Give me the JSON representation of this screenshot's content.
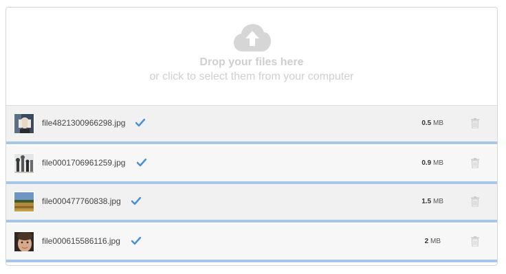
{
  "dropzone": {
    "icon": "cloud-upload-icon",
    "title": "Drop your files here",
    "subtitle": "or click to select them from your computer"
  },
  "colors": {
    "accent": "#4a90d9",
    "progress_bar": "#a7c7e9",
    "muted_text": "#cfcfcf"
  },
  "files": [
    {
      "name": "file4821300966298.jpg",
      "size_value": "0.5",
      "size_unit": "MB",
      "status": "uploaded",
      "progress": 1.0,
      "thumb": "portrait-hands-face"
    },
    {
      "name": "file0001706961259.jpg",
      "size_value": "0.9",
      "size_unit": "MB",
      "status": "uploaded",
      "progress": 1.0,
      "thumb": "chess-pieces"
    },
    {
      "name": "file000477760838.jpg",
      "size_value": "1.5",
      "size_unit": "MB",
      "status": "uploaded",
      "progress": 1.0,
      "thumb": "field-landscape"
    },
    {
      "name": "file000615586116.jpg",
      "size_value": "2",
      "size_unit": "MB",
      "status": "uploaded",
      "progress": 1.0,
      "thumb": "child-face"
    }
  ]
}
